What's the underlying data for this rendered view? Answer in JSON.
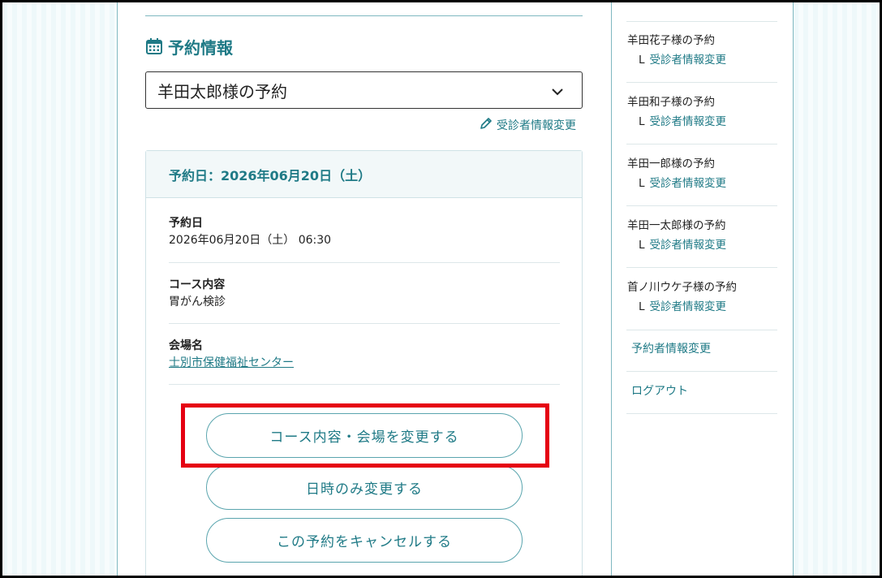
{
  "section": {
    "title": "予約情報",
    "icon": "calendar-icon"
  },
  "select": {
    "value": "羊田太郎様の予約",
    "icon": "chevron-down-icon"
  },
  "edit_link": {
    "label": "受診者情報変更",
    "icon": "pencil-icon"
  },
  "card": {
    "header": "予約日：2026年06月20日（土）",
    "rows": [
      {
        "label": "予約日",
        "value": "2026年06月20日（土） 06:30"
      },
      {
        "label": "コース内容",
        "value": "胃がん検診"
      },
      {
        "label": "会場名",
        "value": "士別市保健福祉センター"
      }
    ]
  },
  "buttons": {
    "change_course": "コース内容・会場を変更する",
    "change_time": "日時のみ変更する",
    "cancel": "この予約をキャンセルする"
  },
  "sidebar": {
    "items": [
      {
        "name": "羊田花子様の予約",
        "sub_prefix": "L",
        "sub": "受診者情報変更"
      },
      {
        "name": "羊田和子様の予約",
        "sub_prefix": "L",
        "sub": "受診者情報変更"
      },
      {
        "name": "羊田一郎様の予約",
        "sub_prefix": "L",
        "sub": "受診者情報変更"
      },
      {
        "name": "羊田一太郎様の予約",
        "sub_prefix": "L",
        "sub": "受診者情報変更"
      },
      {
        "name": "首ノ川ウケ子様の予約",
        "sub_prefix": "L",
        "sub": "受診者情報変更"
      }
    ],
    "reserver_change": "予約者情報変更",
    "logout": "ログアウト"
  },
  "colors": {
    "accent": "#1f7a86",
    "highlight": "#e50012",
    "border": "#7fb8c0"
  }
}
